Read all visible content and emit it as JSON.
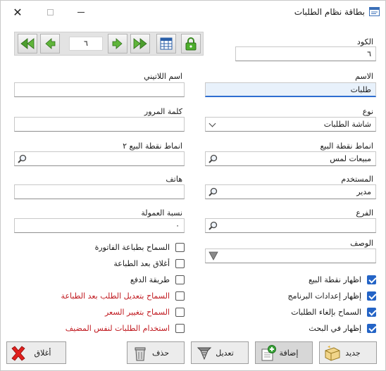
{
  "window": {
    "title": "بطاقة نظام الطلبات",
    "close_glyph": "✕"
  },
  "navigation": {
    "record_number": "٦",
    "icons": [
      "first-icon",
      "previous-icon",
      "next-icon",
      "last-icon",
      "grid-icon",
      "lock-icon"
    ]
  },
  "form": {
    "code": {
      "label": "الكود",
      "value": "٦"
    },
    "name": {
      "label": "الاسم",
      "value": "طلبات"
    },
    "latin_name": {
      "label": "اسم اللاتيني",
      "value": ""
    },
    "type": {
      "label": "نوع",
      "value": "شاشة الطلبات"
    },
    "password": {
      "label": "كلمة المرور",
      "value": ""
    },
    "pos_styles": {
      "label": "انماط نقطة البيع",
      "value": "مبيعات لمس"
    },
    "pos_styles_2": {
      "label": "انماط نقطة البيع ٢",
      "value": ""
    },
    "user": {
      "label": "المستخدم",
      "value": "مدير"
    },
    "phone": {
      "label": "هاتف",
      "value": ""
    },
    "branch": {
      "label": "الفرع",
      "value": ""
    },
    "commission": {
      "label": "نسبة العمولة",
      "value": "٠"
    },
    "description": {
      "label": "الوصف",
      "value": ""
    }
  },
  "checkboxes_right": [
    {
      "label": "اظهار نقطة البيع",
      "checked": true,
      "red": false
    },
    {
      "label": "إظهار إعدادات البرنامج",
      "checked": true,
      "red": false
    },
    {
      "label": "السماح بإلغاء الطلبات",
      "checked": true,
      "red": false
    },
    {
      "label": "إظهار في البحث",
      "checked": true,
      "red": false
    }
  ],
  "checkboxes_left": [
    {
      "label": "السماح بطباعة الفاتورة",
      "checked": false,
      "red": false
    },
    {
      "label": "أغلاق بعد الطباعة",
      "checked": false,
      "red": false
    },
    {
      "label": "طريقة الدفع",
      "checked": false,
      "red": false
    },
    {
      "label": "السماح بتعديل الطلب بعد الطباعة",
      "checked": false,
      "red": true
    },
    {
      "label": "السماح بتغيير السعر",
      "checked": false,
      "red": true
    },
    {
      "label": "استخدام الطلبات لنفس المضيف",
      "checked": false,
      "red": true
    }
  ],
  "buttons": {
    "new": "جديد",
    "add": "إضافة",
    "edit": "تعديل",
    "delete": "حذف",
    "close": "أغلاق"
  },
  "colors": {
    "accent": "#2464c6",
    "warning_text": "#c0191f",
    "active_field": "#e8f1fb"
  }
}
